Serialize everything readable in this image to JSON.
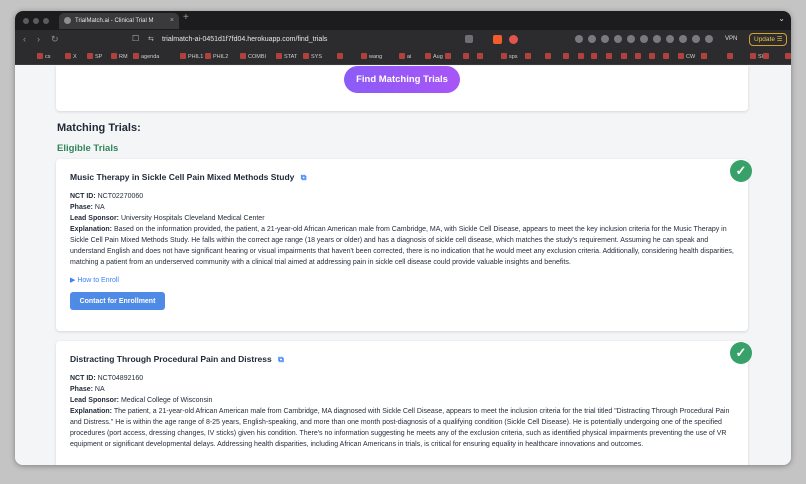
{
  "browser": {
    "tab_title": "TrialMatch.ai - Clinical Trial M",
    "tab_close": "×",
    "new_tab": "+",
    "url": "trialmatch-ai-0451d1f7fd04.herokuapp.com/find_trials",
    "vpn_label": "VPN",
    "update_label": "Update ☰"
  },
  "bookmarks": [
    "cs",
    "X",
    "SP",
    "RM",
    "agenda",
    "PHIL1",
    "PHIL2",
    "COMBI",
    "STAT",
    "SYS",
    "",
    "wang",
    "ai",
    "Aug",
    "",
    "",
    "",
    "sps",
    "",
    "",
    "",
    "",
    "",
    "",
    "",
    "",
    "",
    "",
    "CW",
    "",
    "",
    "SW",
    "",
    "CP"
  ],
  "page": {
    "find_button": "Find Matching Trials",
    "section_title": "Matching Trials:",
    "eligible_title": "Eligible Trials",
    "trials": [
      {
        "title": "Music Therapy in Sickle Cell Pain Mixed Methods Study",
        "nct_label": "NCT ID:",
        "nct_id": "NCT02270060",
        "phase_label": "Phase:",
        "phase": "NA",
        "sponsor_label": "Lead Sponsor:",
        "sponsor": "University Hospitals Cleveland Medical Center",
        "explanation_label": "Explanation:",
        "explanation": "Based on the information provided, the patient, a 21-year-old African American male from Cambridge, MA, with Sickle Cell Disease, appears to meet the key inclusion criteria for the Music Therapy in Sickle Cell Pain Mixed Methods Study. He falls within the correct age range (18 years or older) and has a diagnosis of sickle cell disease, which matches the study's requirement. Assuming he can speak and understand English and does not have significant hearing or visual impairments that haven't been corrected, there is no indication that he would meet any exclusion criteria. Additionally, considering health disparities, matching a patient from an underserved community with a clinical trial aimed at addressing pain in sickle cell disease could provide valuable insights and benefits.",
        "how_to_enroll": "▶ How to Enroll",
        "contact_button": "Contact for Enrollment",
        "check": "✓"
      },
      {
        "title": "Distracting Through Procedural Pain and Distress",
        "nct_label": "NCT ID:",
        "nct_id": "NCT04892160",
        "phase_label": "Phase:",
        "phase": "NA",
        "sponsor_label": "Lead Sponsor:",
        "sponsor": "Medical College of Wisconsin",
        "explanation_label": "Explanation:",
        "explanation": "The patient, a 21-year-old African American male from Cambridge, MA diagnosed with Sickle Cell Disease, appears to meet the inclusion criteria for the trial titled \"Distracting Through Procedural Pain and Distress.\" He is within the age range of 8-25 years, English-speaking, and more than one month post-diagnosis of a qualifying condition (Sickle Cell Disease). He is potentially undergoing one of the specified procedures (port access, dressing changes, IV sticks) given his condition. There's no information suggesting he meets any of the exclusion criteria, such as identified physical impairments preventing the use of VR equipment or significant developmental delays. Addressing health disparities, including African Americans in trials, is critical for ensuring equality in healthcare innovations and outcomes.",
        "check": "✓"
      }
    ]
  },
  "icons": {
    "external_link": "⧉",
    "back": "‹",
    "forward": "›",
    "reload": "↻",
    "bookmark": "☐",
    "site_info": "⇆"
  },
  "colors": {
    "accent_purple": "#9b5cf6",
    "eligible_green": "#2f855a",
    "check_green": "#38a169",
    "link_blue": "#3b82f6",
    "contact_blue": "#4f8ae6"
  }
}
